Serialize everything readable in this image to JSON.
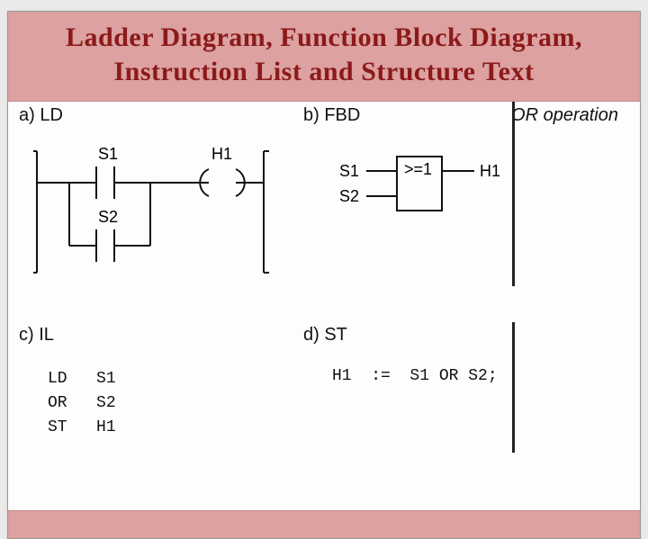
{
  "title": {
    "line1": "Ladder Diagram, Function Block Diagram,",
    "line2": "Instruction List and Structure Text"
  },
  "operation_label": "OR operation",
  "sections": {
    "a": {
      "label": "a) LD"
    },
    "b": {
      "label": "b) FBD"
    },
    "c": {
      "label": "c) IL"
    },
    "d": {
      "label": "d) ST"
    }
  },
  "ld": {
    "contact_top": "S1",
    "contact_bottom": "S2",
    "coil": "H1"
  },
  "fbd": {
    "in1": "S1",
    "in2": "S2",
    "block_label": ">=1",
    "out": "H1"
  },
  "il": {
    "rows": [
      {
        "op": "LD",
        "arg": "S1"
      },
      {
        "op": "OR",
        "arg": "S2"
      },
      {
        "op": "ST",
        "arg": "H1"
      }
    ]
  },
  "st": {
    "code": "H1  :=  S1 OR S2;"
  }
}
